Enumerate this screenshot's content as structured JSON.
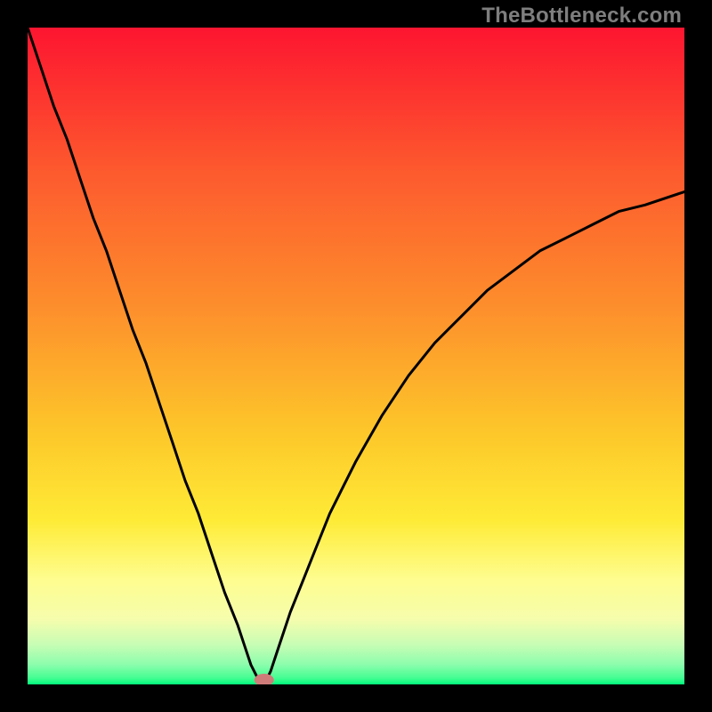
{
  "watermark": {
    "text": "TheBottleneck.com"
  },
  "chart_data": {
    "type": "line",
    "title": "",
    "xlabel": "",
    "ylabel": "",
    "xlim": [
      0,
      100
    ],
    "ylim": [
      0,
      100
    ],
    "grid": false,
    "legend": false,
    "series": [
      {
        "name": "bottleneck-curve",
        "x": [
          0,
          2,
          4,
          6,
          8,
          10,
          12,
          14,
          16,
          18,
          20,
          22,
          24,
          26,
          28,
          30,
          32,
          33,
          34,
          35,
          36,
          37,
          38,
          40,
          42,
          44,
          46,
          48,
          50,
          54,
          58,
          62,
          66,
          70,
          74,
          78,
          82,
          86,
          90,
          94,
          100
        ],
        "y": [
          100,
          94,
          88,
          83,
          77,
          71,
          66,
          60,
          54,
          49,
          43,
          37,
          31,
          26,
          20,
          14,
          9,
          6,
          3,
          1,
          0,
          2,
          5,
          11,
          16,
          21,
          26,
          30,
          34,
          41,
          47,
          52,
          56,
          60,
          63,
          66,
          68,
          70,
          72,
          73,
          75
        ]
      }
    ],
    "marker": {
      "name": "optimal-marker",
      "x": 36,
      "y": 0,
      "color": "#cf7b79"
    },
    "background_gradient": {
      "stops": [
        {
          "y": 100,
          "color": "#fd1530"
        },
        {
          "y": 60,
          "color": "#fd8d2c"
        },
        {
          "y": 30,
          "color": "#feeധ"
        },
        {
          "y": 14,
          "color": "#fefd8f"
        },
        {
          "y": 8,
          "color": "#f6fdac"
        },
        {
          "y": 4,
          "color": "#c7fdb5"
        },
        {
          "y": 1,
          "color": "#62fd99"
        },
        {
          "y": 0,
          "color": "#01fc7c"
        }
      ]
    }
  }
}
